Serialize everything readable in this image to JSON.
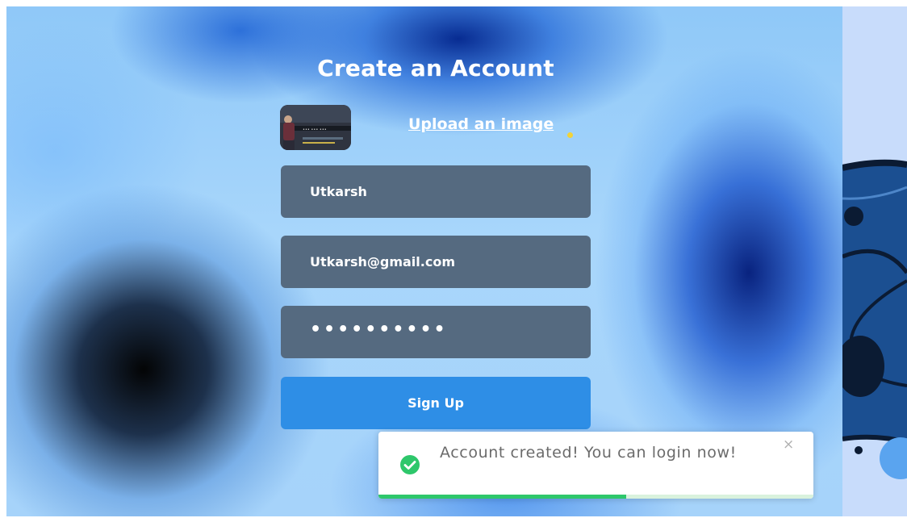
{
  "form": {
    "title": "Create an Account",
    "upload_label": "Upload an image",
    "name_value": "Utkarsh",
    "email_value": "Utkarsh@gmail.com",
    "password_mask": "••••••••••",
    "submit_label": "Sign Up"
  },
  "toast": {
    "message": "Account created! You can login now!",
    "close_icon": "×",
    "progress": 0.57
  },
  "colors": {
    "field_bg": "#556a80",
    "button_bg": "#2e8ee6",
    "success": "#2ec76b",
    "toast_text": "#6b6b6b"
  },
  "icons": [
    "check-circle-icon",
    "close-icon"
  ]
}
